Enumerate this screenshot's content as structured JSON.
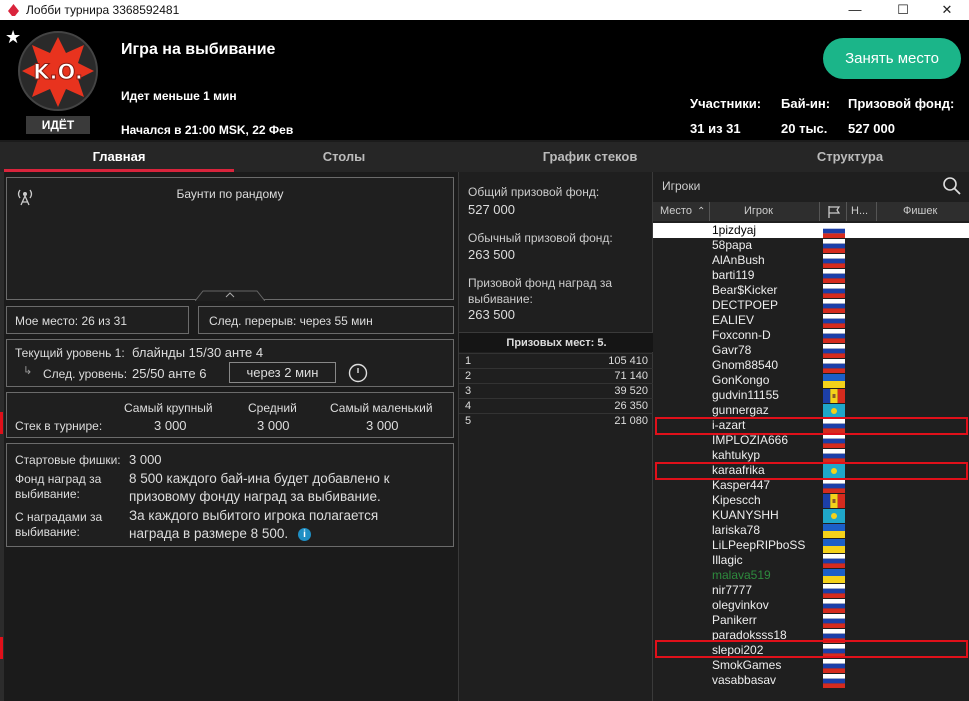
{
  "window": {
    "title": "Лобби турнира 3368592481",
    "minimize": "—",
    "maximize": "☐",
    "close": "✕"
  },
  "header": {
    "logo_text": "K.O.",
    "status_badge": "ИДЁТ",
    "tournament_name": "Игра на выбивание",
    "late_reg": "Идет меньше 1 мин",
    "started": "Начался в 21:00 MSK, 22 Фев",
    "take_seat_button": "Занять место",
    "stats": {
      "players_label": "Участники:",
      "players_value": "31 из 31",
      "buyin_label": "Бай-ин:",
      "buyin_value": "20 тыс.",
      "prize_label": "Призовой фонд:",
      "prize_value": "527 000"
    }
  },
  "tabs": [
    "Главная",
    "Столы",
    "График стеков",
    "Структура"
  ],
  "main": {
    "banner_title": "Баунти по рандому",
    "my_place": "Мое место: 26 из 31",
    "next_break": "След. перерыв: через 55 мин",
    "level_label": "Текущий уровень 1:",
    "level_value": "блайнды 15/30 анте  4",
    "next_level_label": "След. уровень:",
    "next_level_value": "25/50 анте  6",
    "next_level_timer": "через 2 мин",
    "stack": {
      "label": "Стек в турнире:",
      "largest_label": "Самый крупный",
      "largest_value": "3 000",
      "average_label": "Средний",
      "average_value": "3 000",
      "smallest_label": "Самый маленький",
      "smallest_value": "3 000"
    },
    "info": {
      "start_chips_label": "Стартовые фишки:",
      "start_chips_value": "3 000",
      "bounty_pool_label_1": "Фонд наград за",
      "bounty_pool_label_2": "выбивание:",
      "bounty_pool_text_1": "8 500 каждого бай-ина будет добавлено к",
      "bounty_pool_text_2": "призовому фонду наград за выбивание.",
      "bounty_label_1": "С наградами за",
      "bounty_label_2": "выбивание:",
      "bounty_text_1": "За каждого выбитого игрока полагается",
      "bounty_text_2": "награда в размере 8 500."
    }
  },
  "prizes": {
    "total_label": "Общий призовой фонд:",
    "total_value": "527 000",
    "regular_label": "Обычный призовой фонд:",
    "regular_value": "263 500",
    "bounty_label_1": "Призовой фонд наград за",
    "bounty_label_2": "выбивание:",
    "bounty_value": "263 500",
    "places_header": "Призовых мест: 5.",
    "places": [
      {
        "place": "1",
        "amount": "105 410"
      },
      {
        "place": "2",
        "amount": "71 140"
      },
      {
        "place": "3",
        "amount": "39 520"
      },
      {
        "place": "4",
        "amount": "26 350"
      },
      {
        "place": "5",
        "amount": "21 080"
      }
    ]
  },
  "players": {
    "title": "Игроки",
    "columns": {
      "place": "Место",
      "player": "Игрок",
      "n": "Н...",
      "chips": "Фишек"
    },
    "list": [
      {
        "name": "1pizdyaj",
        "flag": "ru"
      },
      {
        "name": "58papa",
        "flag": "ru"
      },
      {
        "name": "AlAnBush",
        "flag": "ru"
      },
      {
        "name": "barti119",
        "flag": "ru"
      },
      {
        "name": "Bear$Kicker",
        "flag": "ru"
      },
      {
        "name": "DECTPOEP",
        "flag": "ru"
      },
      {
        "name": "EALIEV",
        "flag": "ru"
      },
      {
        "name": "Foxconn-D",
        "flag": "ru"
      },
      {
        "name": "Gavr78",
        "flag": "ru"
      },
      {
        "name": "Gnom88540",
        "flag": "ru"
      },
      {
        "name": "GonKongo",
        "flag": "ua"
      },
      {
        "name": "gudvin11155",
        "flag": "md"
      },
      {
        "name": "gunnergaz",
        "flag": "kz"
      },
      {
        "name": "i-azart",
        "flag": "ru"
      },
      {
        "name": "IMPLOZIA666",
        "flag": "ru"
      },
      {
        "name": "kahtukyp",
        "flag": "ru"
      },
      {
        "name": "karaafrika",
        "flag": "kz"
      },
      {
        "name": "Kasper447",
        "flag": "ru"
      },
      {
        "name": "Kipescch",
        "flag": "md"
      },
      {
        "name": "KUANYSHH",
        "flag": "kz"
      },
      {
        "name": "lariska78",
        "flag": "ua"
      },
      {
        "name": "LiLPeepRIPboSS",
        "flag": "ua"
      },
      {
        "name": "Illagic",
        "flag": "ru"
      },
      {
        "name": "malava519",
        "flag": "ua"
      },
      {
        "name": "nir7777",
        "flag": "ru"
      },
      {
        "name": "olegvinkov",
        "flag": "ru"
      },
      {
        "name": "Panikerr",
        "flag": "ru"
      },
      {
        "name": "paradoksss18",
        "flag": "ru"
      },
      {
        "name": "slepoi202",
        "flag": "ru"
      },
      {
        "name": "SmokGames",
        "flag": "ru"
      },
      {
        "name": "vasabbasav",
        "flag": "ru"
      }
    ],
    "colors": {
      "highlight_name": "#2e8b3e",
      "selected_row_bg": "#ffffff"
    }
  },
  "colors": {
    "accent_red": "#d9243c",
    "take_seat": "#1bb589",
    "marker_red": "#e0101a"
  }
}
